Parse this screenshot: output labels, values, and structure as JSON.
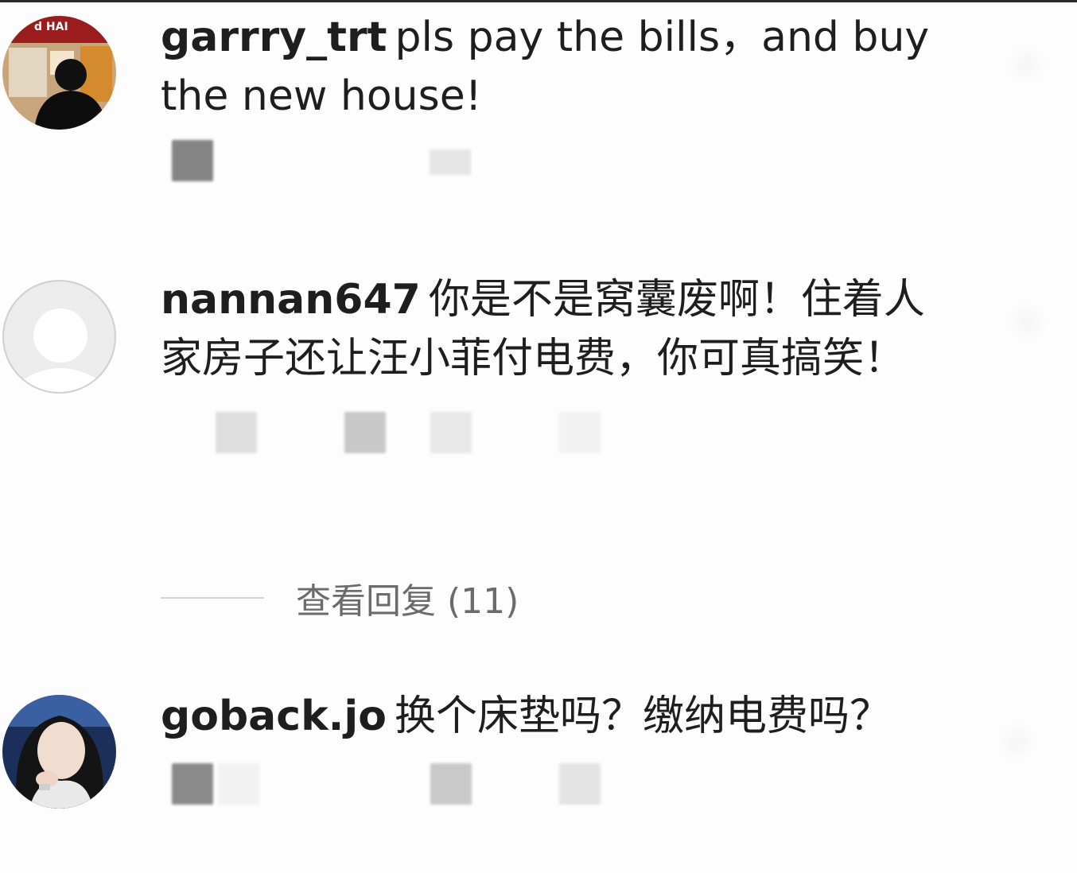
{
  "comments": [
    {
      "username": "garrry_trt",
      "text": "pls pay the bills，and buy the new house!",
      "avatar": "photo-avatar-person-storefront"
    },
    {
      "username": "nannan647",
      "text": "你是不是窝囊废啊！住着人家房子还让汪小菲付电费，你可真搞笑！",
      "avatar": "default-avatar-placeholder"
    },
    {
      "username": "goback.jo",
      "text": "换个床垫吗？缴纳电费吗？",
      "avatar": "photo-avatar-woman"
    }
  ],
  "replies": {
    "label": "查看回复 (11)"
  },
  "colors": {
    "background": "#fdfdfd",
    "text": "#1e1e1e",
    "muted": "#6b6b6b",
    "divider": "#d4d4d4",
    "placeholder_avatar": "#e9e9e9"
  }
}
